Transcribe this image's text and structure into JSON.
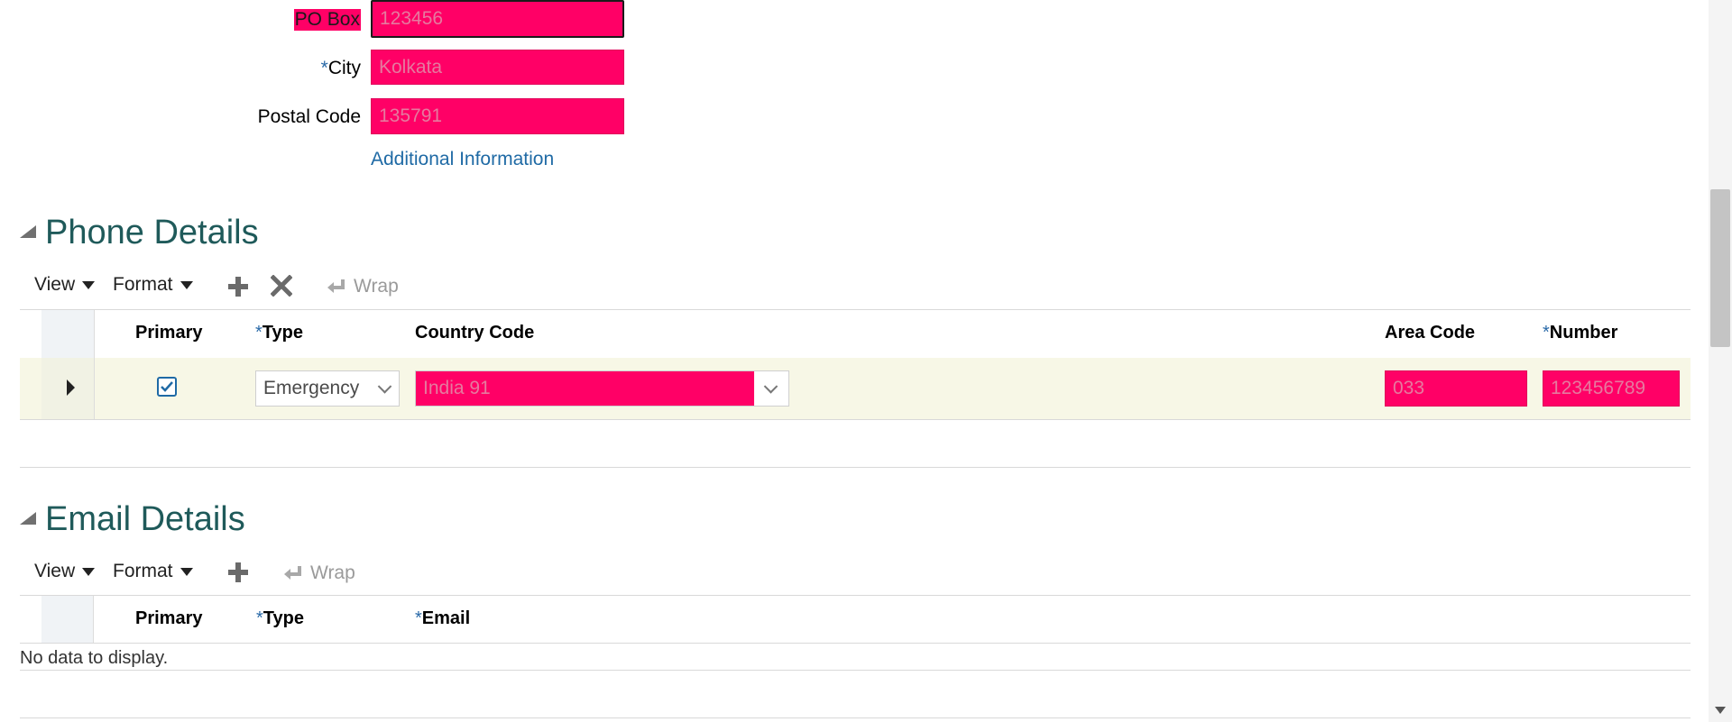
{
  "address": {
    "po_box": {
      "label": "PO Box",
      "value": "123456"
    },
    "city": {
      "required_mark": "*",
      "label": "City",
      "value": "Kolkata"
    },
    "postal_code": {
      "label": "Postal Code",
      "value": "135791"
    },
    "additional_info_link": "Additional Information"
  },
  "phone": {
    "title": "Phone Details",
    "toolbar": {
      "view": "View",
      "format": "Format",
      "wrap": "Wrap"
    },
    "columns": {
      "primary": "Primary",
      "type": "Type",
      "country_code": "Country Code",
      "area_code": "Area Code",
      "number": "Number",
      "required_mark": "*"
    },
    "row": {
      "primary_checked": true,
      "type": "Emergency",
      "country_code": "India 91",
      "area_code": "033",
      "number": "123456789"
    }
  },
  "email": {
    "title": "Email Details",
    "toolbar": {
      "view": "View",
      "format": "Format",
      "wrap": "Wrap"
    },
    "columns": {
      "primary": "Primary",
      "type": "Type",
      "email": "Email",
      "required_mark": "*"
    },
    "empty_message": "No data to display."
  },
  "colors": {
    "highlight": "#ff0066",
    "link": "#1f6aa5",
    "section_title": "#1f5a5a",
    "row_selected": "#f7f7e6"
  }
}
